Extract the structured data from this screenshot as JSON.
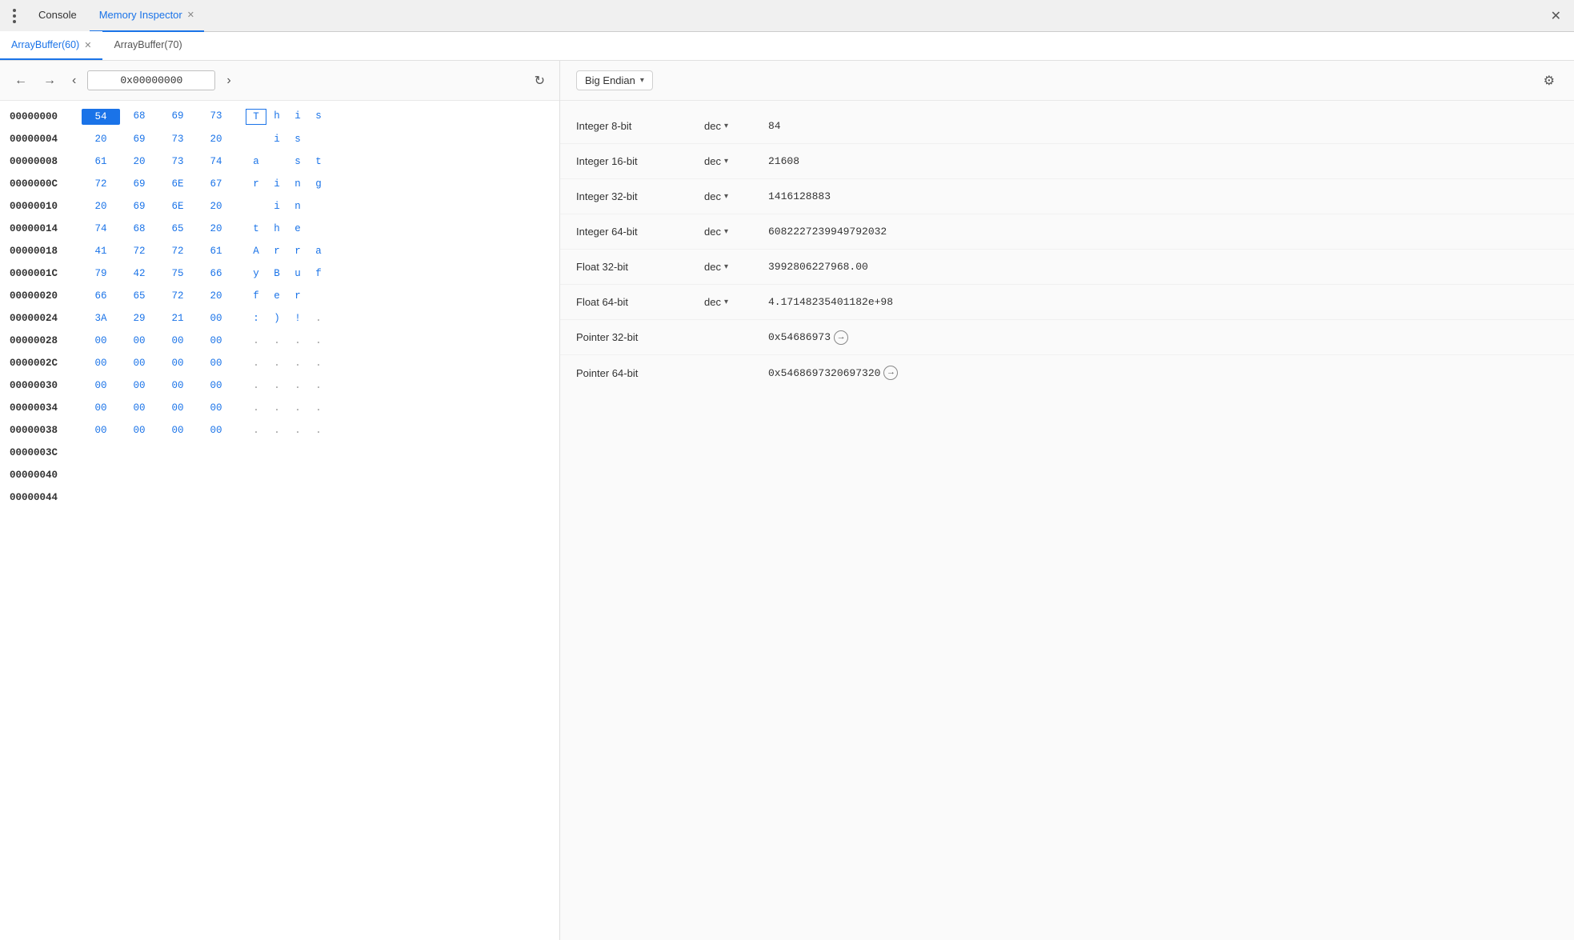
{
  "topBar": {
    "dotsLabel": "⋮",
    "consoleTab": "Console",
    "memoryInspectorTab": "Memory Inspector",
    "closeIcon": "✕"
  },
  "subTabs": [
    {
      "label": "ArrayBuffer(60)",
      "active": true,
      "closable": true
    },
    {
      "label": "ArrayBuffer(70)",
      "active": false,
      "closable": false
    }
  ],
  "navBar": {
    "backDisabled": false,
    "forwardDisabled": false,
    "prevIcon": "‹",
    "nextIcon": "›",
    "address": "0x00000000",
    "refreshIcon": "↺"
  },
  "hexRows": [
    {
      "address": "00000000",
      "bytes": [
        "54",
        "68",
        "69",
        "73"
      ],
      "selectedByteIndex": 0,
      "chars": [
        "T",
        "h",
        "i",
        "s"
      ],
      "selectedCharIndex": 0,
      "charsAreText": [
        true,
        true,
        true,
        true
      ]
    },
    {
      "address": "00000004",
      "bytes": [
        "20",
        "69",
        "73",
        "20"
      ],
      "selectedByteIndex": -1,
      "chars": [
        " ",
        "i",
        "s",
        " "
      ],
      "charsAreText": [
        false,
        true,
        true,
        false
      ]
    },
    {
      "address": "00000008",
      "bytes": [
        "61",
        "20",
        "73",
        "74"
      ],
      "selectedByteIndex": -1,
      "chars": [
        "a",
        " ",
        "s",
        "t"
      ],
      "charsAreText": [
        true,
        false,
        true,
        true
      ]
    },
    {
      "address": "0000000C",
      "bytes": [
        "72",
        "69",
        "6E",
        "67"
      ],
      "selectedByteIndex": -1,
      "chars": [
        "r",
        "i",
        "n",
        "g"
      ],
      "charsAreText": [
        true,
        true,
        true,
        true
      ]
    },
    {
      "address": "00000010",
      "bytes": [
        "20",
        "69",
        "6E",
        "20"
      ],
      "selectedByteIndex": -1,
      "chars": [
        " ",
        "i",
        "n",
        " "
      ],
      "charsAreText": [
        false,
        true,
        true,
        false
      ]
    },
    {
      "address": "00000014",
      "bytes": [
        "74",
        "68",
        "65",
        "20"
      ],
      "selectedByteIndex": -1,
      "chars": [
        "t",
        "h",
        "e",
        " "
      ],
      "charsAreText": [
        true,
        true,
        true,
        false
      ]
    },
    {
      "address": "00000018",
      "bytes": [
        "41",
        "72",
        "72",
        "61"
      ],
      "selectedByteIndex": -1,
      "chars": [
        "A",
        "r",
        "r",
        "a"
      ],
      "charsAreText": [
        true,
        true,
        true,
        true
      ]
    },
    {
      "address": "0000001C",
      "bytes": [
        "79",
        "42",
        "75",
        "66"
      ],
      "selectedByteIndex": -1,
      "chars": [
        "y",
        "B",
        "u",
        "f"
      ],
      "charsAreText": [
        true,
        true,
        true,
        true
      ]
    },
    {
      "address": "00000020",
      "bytes": [
        "66",
        "65",
        "72",
        "20"
      ],
      "selectedByteIndex": -1,
      "chars": [
        "f",
        "e",
        "r",
        " "
      ],
      "charsAreText": [
        true,
        true,
        true,
        false
      ]
    },
    {
      "address": "00000024",
      "bytes": [
        "3A",
        "29",
        "21",
        "00"
      ],
      "selectedByteIndex": -1,
      "chars": [
        ":",
        ")",
        "!",
        "."
      ],
      "charsAreText": [
        true,
        true,
        true,
        false
      ]
    },
    {
      "address": "00000028",
      "bytes": [
        "00",
        "00",
        "00",
        "00"
      ],
      "selectedByteIndex": -1,
      "chars": [
        ".",
        ".",
        ".",
        "."
      ],
      "charsAreText": [
        false,
        false,
        false,
        false
      ]
    },
    {
      "address": "0000002C",
      "bytes": [
        "00",
        "00",
        "00",
        "00"
      ],
      "selectedByteIndex": -1,
      "chars": [
        ".",
        ".",
        ".",
        "."
      ],
      "charsAreText": [
        false,
        false,
        false,
        false
      ]
    },
    {
      "address": "00000030",
      "bytes": [
        "00",
        "00",
        "00",
        "00"
      ],
      "selectedByteIndex": -1,
      "chars": [
        ".",
        ".",
        ".",
        "."
      ],
      "charsAreText": [
        false,
        false,
        false,
        false
      ]
    },
    {
      "address": "00000034",
      "bytes": [
        "00",
        "00",
        "00",
        "00"
      ],
      "selectedByteIndex": -1,
      "chars": [
        ".",
        ".",
        ".",
        "."
      ],
      "charsAreText": [
        false,
        false,
        false,
        false
      ]
    },
    {
      "address": "00000038",
      "bytes": [
        "00",
        "00",
        "00",
        "00"
      ],
      "selectedByteIndex": -1,
      "chars": [
        ".",
        ".",
        ".",
        "."
      ],
      "charsAreText": [
        false,
        false,
        false,
        false
      ]
    },
    {
      "address": "0000003C",
      "bytes": [],
      "selectedByteIndex": -1,
      "chars": [],
      "charsAreText": []
    },
    {
      "address": "00000040",
      "bytes": [],
      "selectedByteIndex": -1,
      "chars": [],
      "charsAreText": []
    },
    {
      "address": "00000044",
      "bytes": [],
      "selectedByteIndex": -1,
      "chars": [],
      "charsAreText": []
    }
  ],
  "inspector": {
    "endian": "Big Endian",
    "dropdownArrow": "▾",
    "gearIcon": "⚙",
    "rows": [
      {
        "type": "Integer 8-bit",
        "format": "dec",
        "hasDropdown": true,
        "value": "84",
        "isPointer": false
      },
      {
        "type": "Integer 16-bit",
        "format": "dec",
        "hasDropdown": true,
        "value": "21608",
        "isPointer": false
      },
      {
        "type": "Integer 32-bit",
        "format": "dec",
        "hasDropdown": true,
        "value": "1416128883",
        "isPointer": false
      },
      {
        "type": "Integer 64-bit",
        "format": "dec",
        "hasDropdown": true,
        "value": "6082227239949792032",
        "isPointer": false
      },
      {
        "type": "Float 32-bit",
        "format": "dec",
        "hasDropdown": true,
        "value": "3992806227968.00",
        "isPointer": false
      },
      {
        "type": "Float 64-bit",
        "format": "dec",
        "hasDropdown": true,
        "value": "4.17148235401182e+98",
        "isPointer": false
      },
      {
        "type": "Pointer 32-bit",
        "format": "",
        "hasDropdown": false,
        "value": "0x54686973",
        "isPointer": true
      },
      {
        "type": "Pointer 64-bit",
        "format": "",
        "hasDropdown": false,
        "value": "0x5468697320697320",
        "isPointer": true
      }
    ]
  }
}
